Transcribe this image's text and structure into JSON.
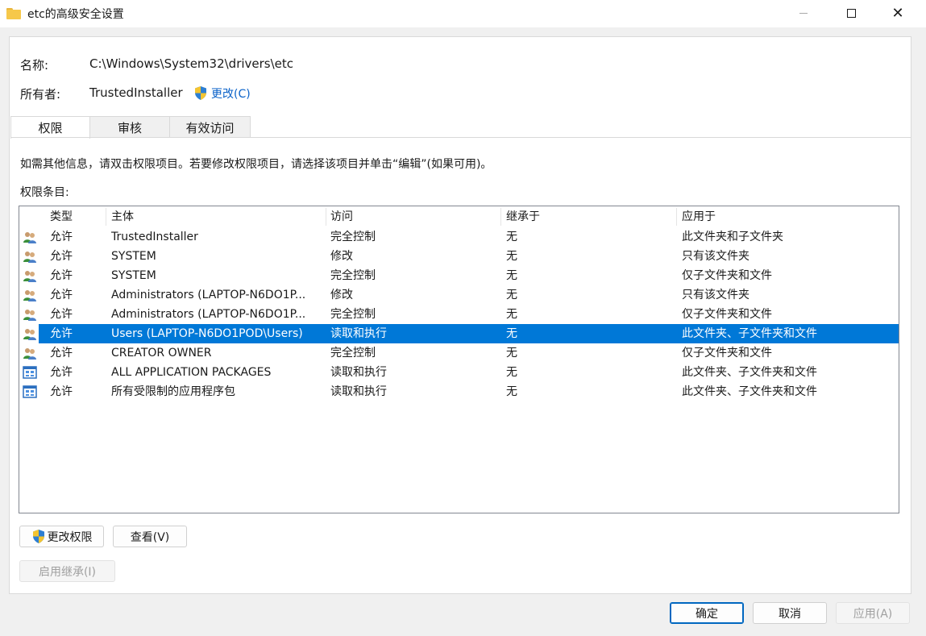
{
  "window": {
    "title": "etc的高级安全设置",
    "icon": "folder-icon",
    "close_glyph": "✕"
  },
  "info": {
    "name_label": "名称:",
    "name_value": "C:\\Windows\\System32\\drivers\\etc",
    "owner_label": "所有者:",
    "owner_value": "TrustedInstaller",
    "owner_change_link": "更改(C)"
  },
  "tabs": [
    {
      "label": "权限",
      "active": true
    },
    {
      "label": "审核",
      "active": false
    },
    {
      "label": "有效访问",
      "active": false
    }
  ],
  "instruction": "如需其他信息，请双击权限项目。若要修改权限项目，请选择该项目并单击“编辑”(如果可用)。",
  "entries_label": "权限条目:",
  "table": {
    "columns": [
      "类型",
      "主体",
      "访问",
      "继承于",
      "应用于"
    ],
    "rows": [
      {
        "icon": "users-icon",
        "type": "允许",
        "principal": "TrustedInstaller",
        "access": "完全控制",
        "inherited": "无",
        "applies": "此文件夹和子文件夹",
        "selected": false
      },
      {
        "icon": "users-icon",
        "type": "允许",
        "principal": "SYSTEM",
        "access": "修改",
        "inherited": "无",
        "applies": "只有该文件夹",
        "selected": false
      },
      {
        "icon": "users-icon",
        "type": "允许",
        "principal": "SYSTEM",
        "access": "完全控制",
        "inherited": "无",
        "applies": "仅子文件夹和文件",
        "selected": false
      },
      {
        "icon": "users-icon",
        "type": "允许",
        "principal": "Administrators (LAPTOP-N6DO1P...",
        "access": "修改",
        "inherited": "无",
        "applies": "只有该文件夹",
        "selected": false
      },
      {
        "icon": "users-icon",
        "type": "允许",
        "principal": "Administrators (LAPTOP-N6DO1P...",
        "access": "完全控制",
        "inherited": "无",
        "applies": "仅子文件夹和文件",
        "selected": false
      },
      {
        "icon": "users-icon",
        "type": "允许",
        "principal": "Users (LAPTOP-N6DO1POD\\Users)",
        "access": "读取和执行",
        "inherited": "无",
        "applies": "此文件夹、子文件夹和文件",
        "selected": true
      },
      {
        "icon": "users-icon",
        "type": "允许",
        "principal": "CREATOR OWNER",
        "access": "完全控制",
        "inherited": "无",
        "applies": "仅子文件夹和文件",
        "selected": false
      },
      {
        "icon": "app-package-icon",
        "type": "允许",
        "principal": "ALL APPLICATION PACKAGES",
        "access": "读取和执行",
        "inherited": "无",
        "applies": "此文件夹、子文件夹和文件",
        "selected": false
      },
      {
        "icon": "app-package-icon",
        "type": "允许",
        "principal": "所有受限制的应用程序包",
        "access": "读取和执行",
        "inherited": "无",
        "applies": "此文件夹、子文件夹和文件",
        "selected": false
      }
    ]
  },
  "buttons": {
    "change_permissions": "更改权限",
    "view": "查看(V)",
    "enable_inheritance": "启用继承(I)",
    "ok": "确定",
    "cancel": "取消",
    "apply": "应用(A)"
  },
  "colors": {
    "selection": "#0078d7",
    "link": "#0a62c9"
  }
}
